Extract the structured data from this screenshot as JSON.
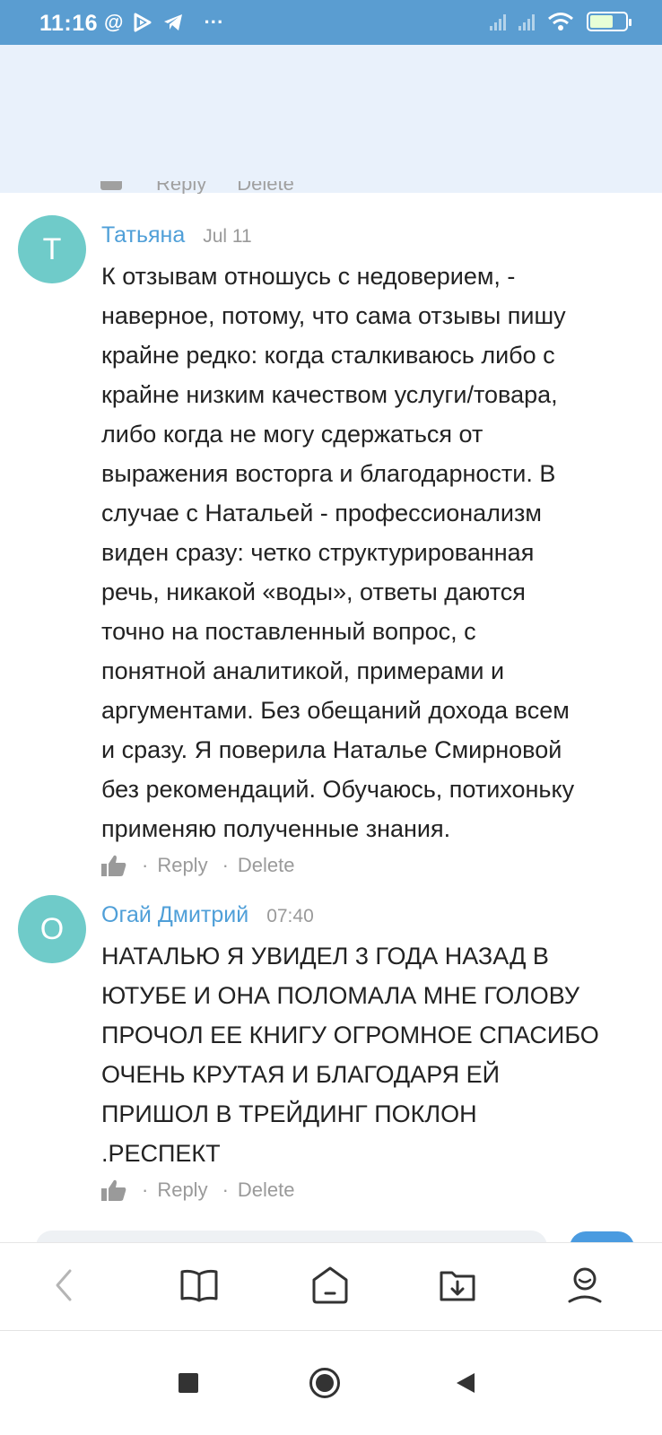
{
  "status_bar": {
    "time": "11:16",
    "left_icons": [
      "at-icon",
      "play-icon",
      "telegram-icon",
      "more-icon"
    ],
    "more_text": "···",
    "at_text": "@"
  },
  "partial_actions": {
    "reply": "Reply",
    "delete": "Delete"
  },
  "comments": [
    {
      "avatar_letter": "Т",
      "avatar_color": "#6fcbc9",
      "author": "Татьяна",
      "date": "Jul 11",
      "text": "К отзывам отношусь с недоверием, -\nнаверное, потому, что сама отзывы пишу\nкрайне редко: когда сталкиваюсь либо с\nкрайне низким качеством услуги/товара,\nлибо когда не могу сдержаться от\nвыражения восторга и благодарности. В\nслучае с Натальей - профессионализм\nвиден сразу: четко структурированная\nречь, никакой «воды», ответы даются\nточно на поставленный вопрос, с\nпонятной аналитикой, примерами и\nаргументами. Без обещаний дохода всем\nи сразу. Я поверила Наталье Смирновой\nбез рекомендаций. Обучаюсь, потихоньку\nприменяю полученные знания.",
      "reply": "Reply",
      "delete": "Delete"
    },
    {
      "avatar_letter": "О",
      "avatar_color": "#6fcbc9",
      "author": "Огай Дмитрий",
      "date": "07:40",
      "text": "НАТАЛЬЮ Я УВИДЕЛ 3 ГОДА НАЗАД В\nЮТУБЕ И ОНА ПОЛОМАЛА МНЕ ГОЛОВУ\nПРОЧОЛ ЕЕ КНИГУ ОГРОМНОЕ СПАСИБО\nОЧЕНЬ КРУТАЯ И БЛАГОДАРЯ ЕЙ\nПРИШОЛ В ТРЕЙДИНГ ПОКЛОН\n.РЕСПЕКТ",
      "reply": "Reply",
      "delete": "Delete"
    }
  ],
  "action_separator": "·",
  "bottom_nav": [
    "back-icon",
    "book-icon",
    "home-icon",
    "download-icon",
    "profile-icon"
  ],
  "android_nav": [
    "recents-icon",
    "home-circle-icon",
    "back-triangle-icon"
  ],
  "colors": {
    "status_bar": "#5a9dd1",
    "author": "#4f9fd8",
    "muted": "#9a9a9a",
    "accent": "#4a9be0"
  }
}
